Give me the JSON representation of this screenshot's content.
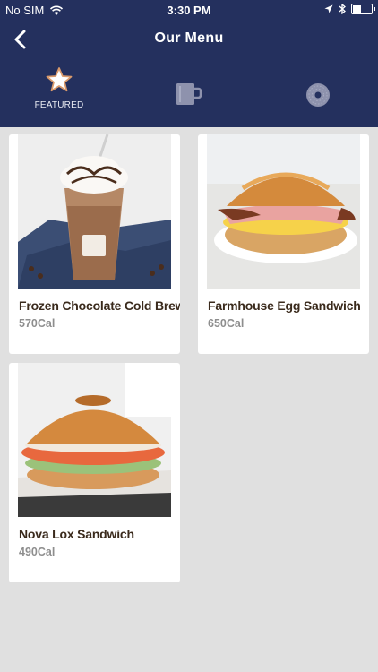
{
  "status_bar": {
    "carrier": "No SIM",
    "time": "3:30 PM",
    "icons": [
      "wifi-icon",
      "location-arrow-icon",
      "bluetooth-icon",
      "battery-icon"
    ]
  },
  "nav": {
    "title": "Our Menu",
    "back_icon": "chevron-left-icon"
  },
  "tabs": [
    {
      "label": "FEATURED",
      "icon": "star-icon",
      "active": true
    },
    {
      "label": "",
      "icon": "coffee-cup-icon",
      "active": false
    },
    {
      "label": "",
      "icon": "bagel-icon",
      "active": false
    }
  ],
  "menu_items": [
    {
      "name": "Frozen Chocolate Cold Brew",
      "calories": "570Cal",
      "image": "frozen-drink-image"
    },
    {
      "name": "Farmhouse Egg Sandwich",
      "calories": "650Cal",
      "image": "egg-sandwich-image"
    },
    {
      "name": "Nova Lox Sandwich",
      "calories": "490Cal",
      "image": "lox-sandwich-image"
    }
  ],
  "colors": {
    "header_bg": "#24305e",
    "page_bg": "#e0e0e0",
    "card_bg": "#ffffff",
    "item_name": "#3a2a1c",
    "calories": "#8e8e8e"
  }
}
